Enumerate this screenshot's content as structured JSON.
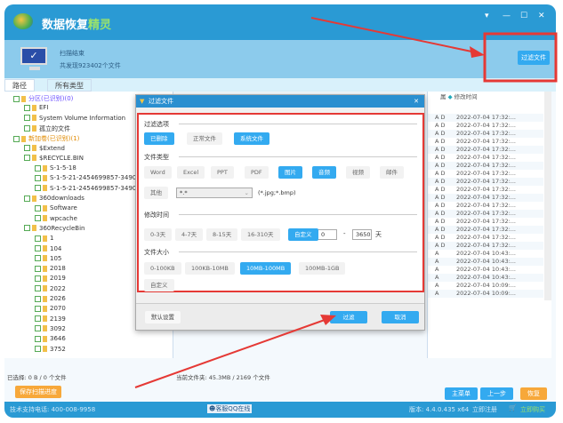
{
  "app": {
    "title_part1": "数据恢复",
    "title_part2": "精灵",
    "status_title": "扫描结束",
    "status_detail": "共发现923402个文件",
    "filter_button": "过滤文件"
  },
  "tabs": [
    "路径",
    "所有类型"
  ],
  "tree": [
    {
      "label": "分区(已识别)(0)",
      "color": "#6a4cff"
    },
    {
      "label": "EFI"
    },
    {
      "label": "System Volume Information"
    },
    {
      "label": "孤立的文件"
    },
    {
      "label": "新加卷(已识别)(1)",
      "color": "#e08a00"
    },
    {
      "label": "$Extend"
    },
    {
      "label": "$RECYCLE.BIN"
    },
    {
      "label": "S-1-5-18"
    },
    {
      "label": "S-1-5-21-2454699857-3490"
    },
    {
      "label": "S-1-5-21-2454699857-3490"
    },
    {
      "label": "360downloads"
    },
    {
      "label": "Software"
    },
    {
      "label": "wpcache"
    },
    {
      "label": "360RecycleBin"
    },
    {
      "label": "1"
    },
    {
      "label": "104"
    },
    {
      "label": "105"
    },
    {
      "label": "2018"
    },
    {
      "label": "2019"
    },
    {
      "label": "2022"
    },
    {
      "label": "2026"
    },
    {
      "label": "2070"
    },
    {
      "label": "2139"
    },
    {
      "label": "3092"
    },
    {
      "label": "3646"
    },
    {
      "label": "3752"
    }
  ],
  "list": {
    "col_attr": "属",
    "col_time": "修改时间",
    "rows": [
      [
        "A D",
        "2022-07-04 17:32:..."
      ],
      [
        "A D",
        "2022-07-04 17:32:..."
      ],
      [
        "A D",
        "2022-07-04 17:32:..."
      ],
      [
        "A D",
        "2022-07-04 17:32:..."
      ],
      [
        "A D",
        "2022-07-04 17:32:..."
      ],
      [
        "A D",
        "2022-07-04 17:32:..."
      ],
      [
        "A D",
        "2022-07-04 17:32:..."
      ],
      [
        "A D",
        "2022-07-04 17:32:..."
      ],
      [
        "A D",
        "2022-07-04 17:32:..."
      ],
      [
        "A D",
        "2022-07-04 17:32:..."
      ],
      [
        "A D",
        "2022-07-04 17:32:..."
      ],
      [
        "A D",
        "2022-07-04 17:32:..."
      ],
      [
        "A D",
        "2022-07-04 17:32:..."
      ],
      [
        "A D",
        "2022-07-04 17:32:..."
      ],
      [
        "A D",
        "2022-07-04 17:32:..."
      ],
      [
        "A D",
        "2022-07-04 17:32:..."
      ],
      [
        "A D",
        "2022-07-04 17:32:..."
      ],
      [
        "A",
        "2022-07-04 10:43:..."
      ],
      [
        "A",
        "2022-07-04 10:43:..."
      ],
      [
        "A",
        "2022-07-04 10:43:..."
      ],
      [
        "A",
        "2022-07-04 10:43:..."
      ],
      [
        "A",
        "2022-07-04 10:09:..."
      ],
      [
        "A",
        "2022-07-04 10:09:..."
      ]
    ]
  },
  "status": {
    "selected": "已选择: 0 B / 0 个文件",
    "current": "当前文件夹: 45.3MB / 2169 个文件",
    "save_progress": "保存扫描进度"
  },
  "nav": {
    "main_menu": "主菜单",
    "prev": "上一步",
    "recover": "恢复"
  },
  "footer": {
    "phone": "技术支持电话: 400-008-9958",
    "qq": "客服QQ在线",
    "version": "版本: 4.4.0.435 x64",
    "register": "立即注册",
    "buy": "立即购买"
  },
  "dialog": {
    "title": "过滤文件",
    "filter_options": {
      "label": "过滤选项",
      "items": [
        {
          "label": "已删除",
          "on": true
        },
        {
          "label": "正常文件",
          "on": false
        },
        {
          "label": "系统文件",
          "on": true
        }
      ]
    },
    "file_type": {
      "label": "文件类型",
      "items": [
        {
          "label": "Word",
          "on": false
        },
        {
          "label": "Excel",
          "on": false
        },
        {
          "label": "PPT",
          "on": false
        },
        {
          "label": "PDF",
          "on": false
        },
        {
          "label": "图片",
          "on": true
        },
        {
          "label": "音频",
          "on": true
        },
        {
          "label": "视频",
          "on": false
        },
        {
          "label": "邮件",
          "on": false
        }
      ],
      "other": "其他",
      "ext_value": "*.*",
      "ext_hint": "(*.jpg;*.bmp)"
    },
    "modified": {
      "label": "修改时间",
      "items": [
        {
          "label": "0-3天",
          "on": false
        },
        {
          "label": "4-7天",
          "on": false
        },
        {
          "label": "8-15天",
          "on": false
        },
        {
          "label": "16-310天",
          "on": false
        },
        {
          "label": "自定义",
          "on": true
        }
      ],
      "from": "0",
      "to": "3650",
      "unit": "天"
    },
    "size": {
      "label": "文件大小",
      "items": [
        {
          "label": "0-100KB",
          "on": false
        },
        {
          "label": "100KB-10MB",
          "on": false
        },
        {
          "label": "10MB-100MB",
          "on": true
        },
        {
          "label": "100MB-1GB",
          "on": false
        },
        {
          "label": "自定义",
          "on": false
        }
      ]
    },
    "default": "默认设置",
    "filter": "过滤",
    "cancel": "取消"
  },
  "colors": {
    "accent": "#33aaf0",
    "titlebar": "#2a9ad4",
    "annotation": "#e53935",
    "orange": "#f7a83a"
  }
}
